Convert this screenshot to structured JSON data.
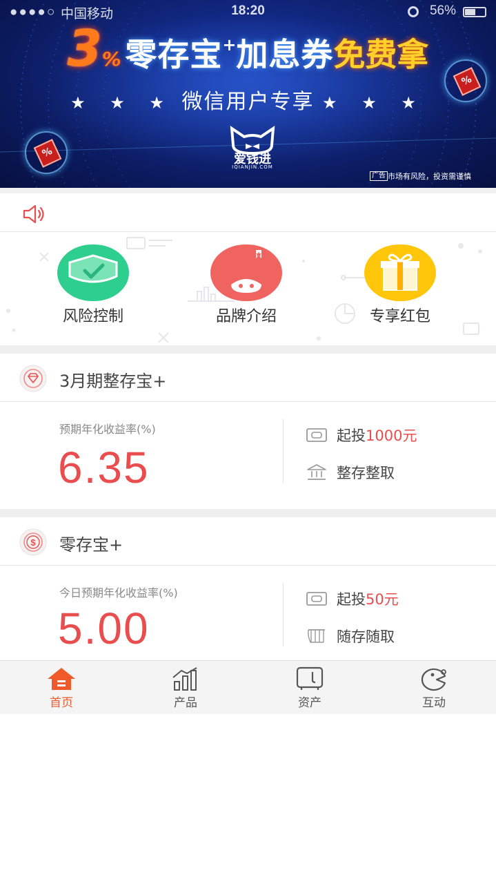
{
  "status_bar": {
    "carrier": "中国移动",
    "time": "18:20",
    "battery": "56%"
  },
  "banner": {
    "headline_number": "3",
    "headline_percent": "%",
    "headline_product": "零存宝",
    "headline_sup": "+",
    "headline_coupon": "加息券",
    "headline_free": "免费拿",
    "subtitle": "微信用户专享",
    "stars": "★ ★ ★",
    "brand_name": "爱钱进",
    "brand_domain": "IQIANJIN.COM",
    "ad_tag": "广告",
    "risk_note": "市场有风险，投资需谨慎",
    "coupon_mark": "%"
  },
  "notice": {
    "icon": "speaker-icon"
  },
  "quick_entries": [
    {
      "label": "风险控制",
      "icon": "shield-check-icon",
      "color": "#2ecf8e"
    },
    {
      "label": "品牌介绍",
      "icon": "brand-cat-icon",
      "color": "#f0645f"
    },
    {
      "label": "专享红包",
      "icon": "gift-icon",
      "color": "#ffc60a"
    }
  ],
  "products": [
    {
      "title": "3月期整存宝+",
      "icon": "diamond-badge-icon",
      "rate_label": "预期年化收益率(%)",
      "rate": "6.35",
      "min_invest_prefix": "起投",
      "min_invest_amount": "1000元",
      "mode": "整存整取"
    },
    {
      "title": "零存宝+",
      "icon": "dollar-badge-icon",
      "rate_label": "今日预期年化收益率(%)",
      "rate": "5.00",
      "min_invest_prefix": "起投",
      "min_invest_amount": "50元",
      "mode": "随存随取"
    }
  ],
  "tabs": [
    {
      "label": "首页",
      "icon": "home-icon",
      "active": true
    },
    {
      "label": "产品",
      "icon": "chart-icon",
      "active": false
    },
    {
      "label": "资产",
      "icon": "safe-icon",
      "active": false
    },
    {
      "label": "互动",
      "icon": "chat-icon",
      "active": false
    }
  ],
  "colors": {
    "accent_red": "#e94d4d",
    "tab_active": "#f0592a",
    "banner_bg": "#0b1a5c"
  }
}
